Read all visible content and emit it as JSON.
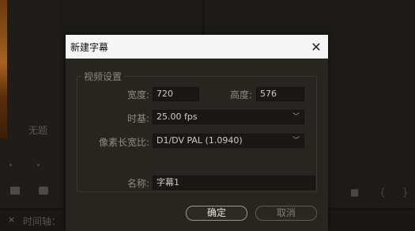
{
  "background": {
    "bin_item_label": "无题",
    "timeline_title": "时间轴：",
    "close_glyph": "×"
  },
  "dialog": {
    "title": "新建字幕",
    "close_glyph": "✕",
    "video_settings": {
      "legend": "视频设置",
      "width_label": "宽度:",
      "width_value": "720",
      "height_label": "高度:",
      "height_value": "576",
      "timebase_label": "时基:",
      "timebase_value": "25.00 fps",
      "par_label": "像素长宽比:",
      "par_value": "D1/DV PAL (1.0940)"
    },
    "name_label": "名称:",
    "name_value": "字幕1",
    "ok_label": "确定",
    "cancel_label": "取消"
  },
  "icons": {
    "dropdown": "chevron-down-icon",
    "close": "close-icon"
  }
}
